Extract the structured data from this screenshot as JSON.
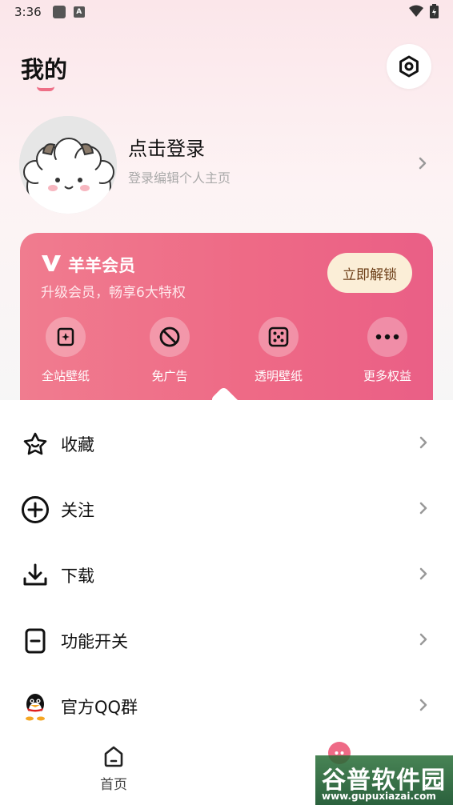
{
  "status": {
    "time": "3:36"
  },
  "header": {
    "title": "我的"
  },
  "profile": {
    "login_title": "点击登录",
    "login_subtitle": "登录编辑个人主页"
  },
  "vip": {
    "name": "羊羊会员",
    "description": "升级会员，畅享6大特权",
    "unlock_label": "立即解锁",
    "perks": [
      {
        "label": "全站壁纸",
        "icon": "wallpaper-icon"
      },
      {
        "label": "免广告",
        "icon": "no-ads-icon"
      },
      {
        "label": "透明壁纸",
        "icon": "dice-icon"
      },
      {
        "label": "更多权益",
        "icon": "more-icon"
      }
    ],
    "colors": {
      "card": "#ee6a86",
      "button": "#fbeed7",
      "button_text": "#6a3b14"
    }
  },
  "menu": [
    {
      "label": "收藏",
      "icon": "star-icon"
    },
    {
      "label": "关注",
      "icon": "plus-circle-icon"
    },
    {
      "label": "下载",
      "icon": "download-icon"
    },
    {
      "label": "功能开关",
      "icon": "toggle-icon"
    },
    {
      "label": "官方QQ群",
      "icon": "qq-penguin-icon"
    }
  ],
  "bottom_nav": {
    "home_label": "首页"
  },
  "watermark": {
    "text": "谷普软件园",
    "url": "www.gupuxiazai.com"
  }
}
